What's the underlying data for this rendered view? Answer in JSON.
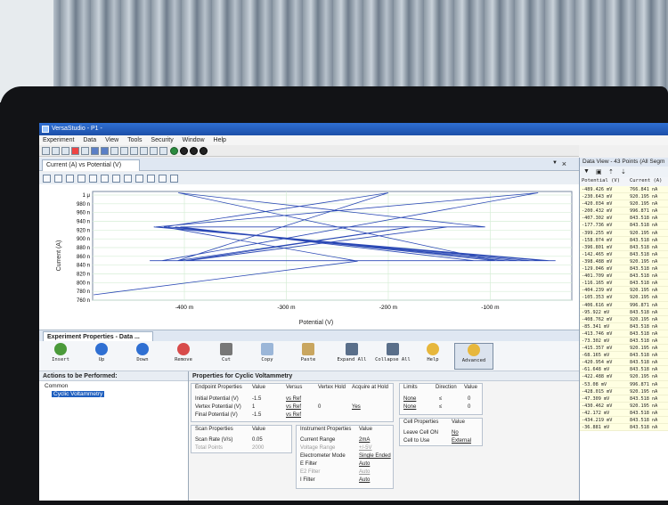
{
  "window": {
    "title": "VersaStudio - P1 -"
  },
  "menu": [
    "Experiment",
    "Data",
    "View",
    "Tools",
    "Security",
    "Window",
    "Help"
  ],
  "graph_tab": {
    "label": "Current (A) vs Potential (V)",
    "close": "×"
  },
  "chart_data": {
    "type": "line",
    "xlabel": "Potential (V)",
    "ylabel": "Current (A)",
    "x_ticks": [
      "-400 m",
      "-300 m",
      "-200 m",
      "-100 m"
    ],
    "y_ticks": [
      "1 μ",
      "980 n",
      "960 n",
      "940 n",
      "920 n",
      "900 n",
      "880 n",
      "860 n",
      "840 n",
      "820 n",
      "800 n",
      "780 n",
      "760 n"
    ],
    "xlim": [
      -0.49,
      -0.02
    ],
    "ylim": [
      7.55e-07,
      1e-06
    ],
    "grid": true,
    "series": [
      {
        "x": [
          -0.489,
          -0.23,
          -0.42,
          -0.2,
          -0.407,
          -0.178,
          -0.399,
          -0.158,
          -0.397,
          -0.142,
          -0.398,
          -0.129,
          -0.402,
          -0.116,
          -0.404,
          -0.105,
          -0.406,
          -0.095,
          -0.409,
          -0.085,
          -0.413,
          -0.073,
          -0.416,
          -0.061,
          -0.422,
          -0.053,
          -0.428,
          -0.047,
          -0.43,
          -0.042,
          -0.434,
          -0.036
        ],
        "y": [
          7.67e-07,
          8.43e-07,
          9.2e-07,
          9.97e-07,
          8.44e-07,
          9.2e-07,
          8.44e-07,
          8.44e-07,
          8.44e-07,
          9.2e-07,
          8.44e-07,
          8.44e-07,
          8.44e-07,
          8.44e-07,
          9.2e-07,
          9.2e-07,
          9.97e-07,
          8.44e-07,
          9.2e-07,
          8.44e-07,
          8.44e-07,
          8.44e-07,
          9.2e-07,
          8.44e-07,
          8.44e-07,
          9.97e-07,
          9.2e-07,
          8.44e-07,
          9.2e-07,
          8.44e-07,
          8.44e-07,
          8.44e-07
        ]
      }
    ]
  },
  "exp_tab": {
    "label": "Experiment Properties - Data ..."
  },
  "actions": [
    "Insert",
    "Up",
    "Down",
    "Remove",
    "Cut",
    "Copy",
    "Paste",
    "Expand All",
    "Collapse All",
    "Help",
    "Advanced"
  ],
  "actions_panel": {
    "title": "Actions to be Performed:",
    "group": "Common",
    "item": "Cyclic Voltammetry"
  },
  "properties": {
    "title": "Properties for Cyclic Voltammetry",
    "endpoint": {
      "headers": [
        "Endpoint Properties",
        "Value",
        "Versus",
        "Vertex Hold",
        "Acquire at Hold"
      ],
      "rows": [
        {
          "name": "Initial Potential (V)",
          "value": "-1.5",
          "versus": "vs Ref",
          "hold": "",
          "acquire": ""
        },
        {
          "name": "Vertex Potential (V)",
          "value": "1",
          "versus": "vs Ref",
          "hold": "0",
          "acquire": "Yes"
        },
        {
          "name": "Final Potential (V)",
          "value": "-1.5",
          "versus": "vs Ref",
          "hold": "",
          "acquire": ""
        }
      ]
    },
    "limits": {
      "headers": [
        "Limits",
        "Direction",
        "Value"
      ],
      "rows": [
        {
          "name": "None",
          "dir": "≤",
          "value": "0"
        },
        {
          "name": "None",
          "dir": "≤",
          "value": "0"
        }
      ]
    },
    "scan": {
      "headers": [
        "Scan Properties",
        "Value"
      ],
      "rows": [
        {
          "name": "Scan Rate (V/s)",
          "value": "0.05"
        },
        {
          "name": "Total Points",
          "value": "2000"
        }
      ]
    },
    "instrument": {
      "headers": [
        "Instrument Properties",
        "Value"
      ],
      "rows": [
        {
          "name": "Current Range",
          "value": "2mA"
        },
        {
          "name": "Voltage Range",
          "value": "+/-5V"
        },
        {
          "name": "Electrometer Mode",
          "value": "Single Ended"
        },
        {
          "name": "E Filter",
          "value": "Auto"
        },
        {
          "name": "E2 Filter",
          "value": "Auto"
        },
        {
          "name": "I Filter",
          "value": "Auto"
        }
      ]
    },
    "cell": {
      "headers": [
        "Cell Properties",
        "Value"
      ],
      "rows": [
        {
          "name": "Leave Cell ON",
          "value": "No"
        },
        {
          "name": "Cell to Use",
          "value": "External"
        }
      ]
    }
  },
  "data_view": {
    "title": "Data View - 43 Points (All Segm",
    "col_potential": "Potential (V)",
    "col_current": "Current (A)",
    "rows": [
      [
        "-489.426 mV",
        "766.841 nA"
      ],
      [
        "-230.643 mV",
        "920.195 nA"
      ],
      [
        "-420.034 mV",
        "920.195 nA"
      ],
      [
        "-200.432 mV",
        "996.871 nA"
      ],
      [
        "-407.302 mV",
        "843.518 nA"
      ],
      [
        "-177.736 mV",
        "843.518 nA"
      ],
      [
        "-399.255 mV",
        "920.195 nA"
      ],
      [
        "-158.074 mV",
        "843.518 nA"
      ],
      [
        "-396.801 mV",
        "843.518 nA"
      ],
      [
        "-142.465 mV",
        "843.518 nA"
      ],
      [
        "-398.488 mV",
        "920.195 nA"
      ],
      [
        "-129.046 mV",
        "843.518 nA"
      ],
      [
        "-401.709 mV",
        "843.518 nA"
      ],
      [
        "-116.165 mV",
        "843.518 nA"
      ],
      [
        "-404.239 mV",
        "920.195 nA"
      ],
      [
        "-105.353 mV",
        "920.195 nA"
      ],
      [
        "-406.616 mV",
        "996.871 nA"
      ],
      [
        "-95.922 mV",
        "843.518 nA"
      ],
      [
        "-408.762 mV",
        "920.195 nA"
      ],
      [
        "-85.341 mV",
        "843.518 nA"
      ],
      [
        "-413.746 mV",
        "843.518 nA"
      ],
      [
        "-73.302 mV",
        "843.518 nA"
      ],
      [
        "-415.357 mV",
        "920.195 nA"
      ],
      [
        "-68.165 mV",
        "843.518 nA"
      ],
      [
        "-420.954 mV",
        "843.518 nA"
      ],
      [
        "-61.648 mV",
        "843.518 nA"
      ],
      [
        "-422.488 mV",
        "920.195 nA"
      ],
      [
        "-53.08 mV",
        "996.871 nA"
      ],
      [
        "-428.015 mV",
        "920.195 nA"
      ],
      [
        "-47.309 mV",
        "843.518 nA"
      ],
      [
        "-430.462 mV",
        "920.195 nA"
      ],
      [
        "-42.172 mV",
        "843.518 nA"
      ],
      [
        "-434.219 mV",
        "843.518 nA"
      ],
      [
        "-36.881 mV",
        "843.518 nA"
      ]
    ]
  },
  "colors": {
    "trace": "#2b49b5",
    "titlebar": "#1c4fa8",
    "selection": "#1f5fbf",
    "data_bg": "#ffffe2"
  }
}
